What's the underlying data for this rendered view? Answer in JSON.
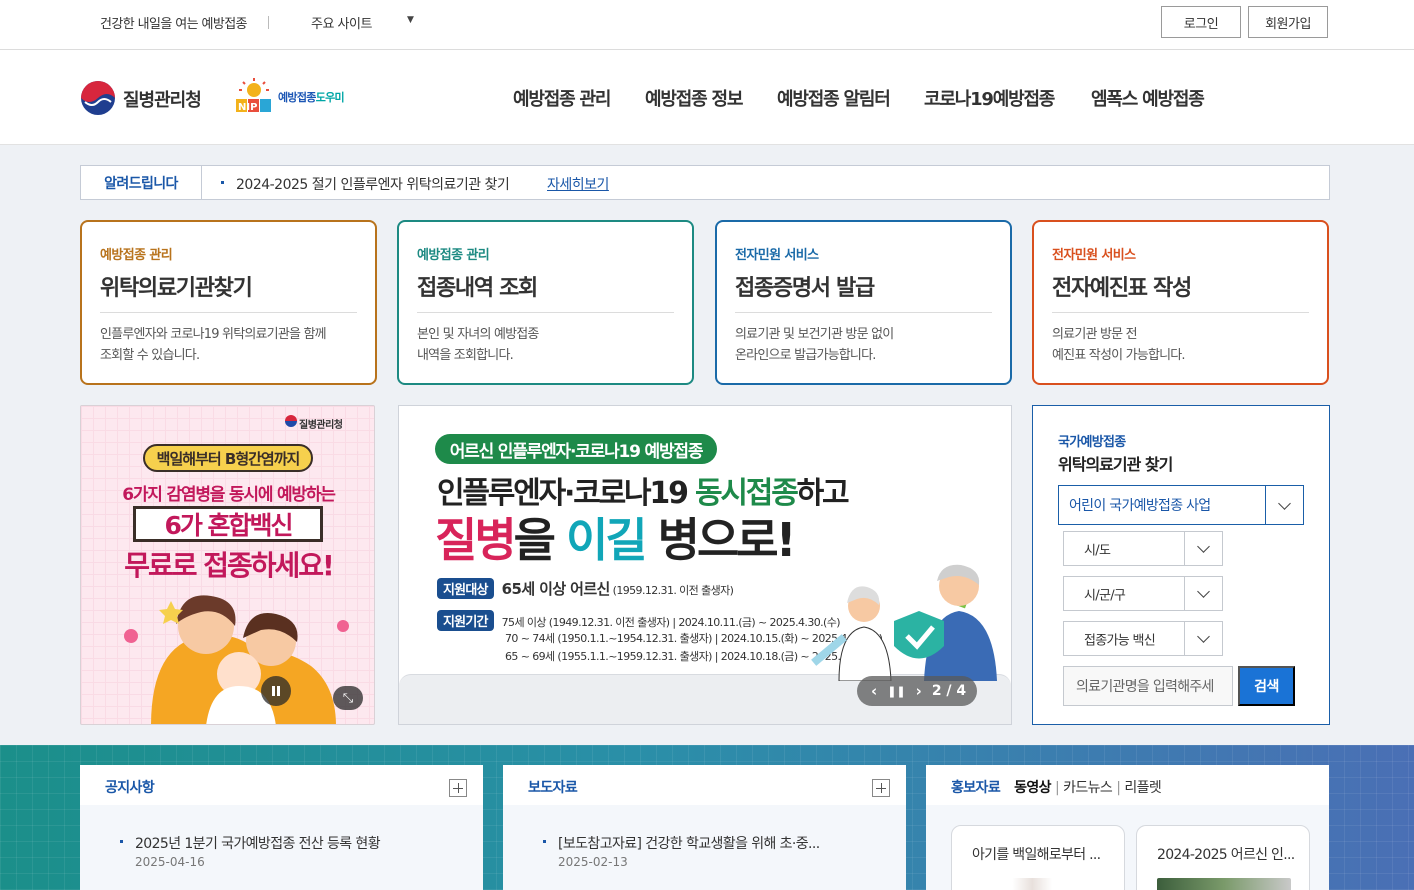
{
  "topbar": {
    "slogan": "건강한 내일을 여는 예방접종",
    "sites_label": "주요 사이트",
    "login": "로그인",
    "join": "회원가입"
  },
  "header": {
    "org_name": "질병관리청",
    "nip_name_main": "예방접종",
    "nip_name_sub": "도우미",
    "nip_mark": "NIP",
    "nav": [
      "예방접종 관리",
      "예방접종 정보",
      "예방접종 알림터",
      "코로나19예방접종",
      "엠폭스 예방접종"
    ]
  },
  "notice": {
    "label": "알려드립니다",
    "text": "2024-2025 절기 인플루엔자 위탁의료기관 찾기",
    "more": "자세히보기"
  },
  "cards": [
    {
      "category": "예방접종 관리",
      "title": "위탁의료기관찾기",
      "desc1": "인플루엔자와 코로나19 위탁의료기관을 함께",
      "desc2": "조회할 수 있습니다.",
      "color": "#b8731c"
    },
    {
      "category": "예방접종 관리",
      "title": "접종내역 조회",
      "desc1": "본인 및 자녀의 예방접종",
      "desc2": "내역을 조회합니다.",
      "color": "#1d8a82"
    },
    {
      "category": "전자민원 서비스",
      "title": "접종증명서 발급",
      "desc1": "의료기관 및 보건기관 방문 없이",
      "desc2": "온라인으로 발급가능합니다.",
      "color": "#1a6aa8"
    },
    {
      "category": "전자민원 서비스",
      "title": "전자예진표 작성",
      "desc1": "의료기관 방문 전",
      "desc2": "예진표 작성이 가능합니다.",
      "color": "#d9501e"
    }
  ],
  "promo": {
    "brand": "질병관리청",
    "tag": "백일해부터 B형간염까지",
    "line1": "6가지 감염병을 동시에 예방하는",
    "line2": "6가 혼합백신",
    "line3": "무료로 접종하세요!"
  },
  "slider": {
    "badge": "어르신 인플루엔자·코로나19 예방접종",
    "headline1_a": "인플루엔자·코로나19 ",
    "headline1_b": "동시접종",
    "headline1_c": "하고",
    "headline2_a": "질병",
    "headline2_b": "을 ",
    "headline2_c": "이길",
    "headline2_d": " 병으로!",
    "target_label": "지원대상",
    "target_text": "65세 이상 어르신",
    "target_note": "(1959.12.31. 이전 출생자)",
    "period_label": "지원기간",
    "periods": [
      "75세 이상 (1949.12.31. 이전 출생자)  |  2024.10.11.(금) ~ 2025.4.30.(수)",
      "70 ~ 74세 (1950.1.1.~1954.12.31. 출생자)  |  2024.10.15.(화) ~ 2025.4.30.(수)",
      "65 ~ 69세 (1955.1.1.~1959.12.31. 출생자)  |  2024.10.18.(금) ~ 2025.4.30.(수)"
    ],
    "counter": "2 / 4"
  },
  "search": {
    "category": "국가예방접종",
    "title": "위탁의료기관 찾기",
    "program": "어린이 국가예방접종 사업",
    "sido": "시/도",
    "sigungu": "시/군/구",
    "vaccine": "접종가능 백신",
    "placeholder": "의료기관명을 입력해주세",
    "button": "검색"
  },
  "bottom": {
    "notice_title": "공지사항",
    "notice_item": "2025년 1분기 국가예방접종 전산 등록 현황",
    "notice_date": "2025-04-16",
    "press_title": "보도자료",
    "press_item": "[보도참고자료] 건강한 학교생활을 위해 초·중...",
    "press_date": "2025-02-13",
    "promo_title": "홍보자료",
    "promo_tabs": [
      "동영상",
      "카드뉴스",
      "리플렛"
    ],
    "videos": [
      "아기를 백일해로부터 ...",
      "2024-2025 어르신 인..."
    ]
  }
}
